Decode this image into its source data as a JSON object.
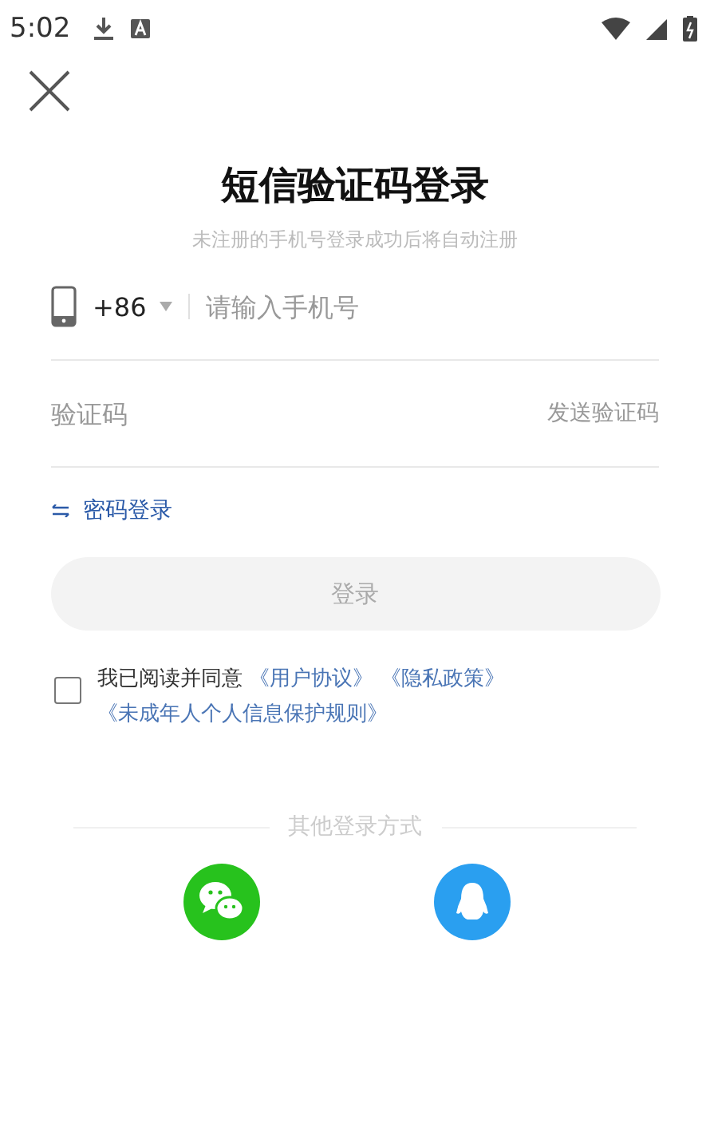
{
  "status_bar": {
    "time": "5:02"
  },
  "title": "短信验证码登录",
  "subtitle": "未注册的手机号登录成功后将自动注册",
  "phone": {
    "country_code": "+86",
    "placeholder": "请输入手机号"
  },
  "code": {
    "placeholder": "验证码",
    "send_label": "发送验证码"
  },
  "switch_login": {
    "label": "密码登录"
  },
  "login_button": {
    "label": "登录",
    "disabled": true
  },
  "agreement": {
    "checked": false,
    "text": "我已阅读并同意",
    "links": [
      "《用户协议》",
      "《隐私政策》",
      "《未成年人个人信息保护规则》"
    ]
  },
  "other_login": {
    "label": "其他登录方式",
    "options": [
      {
        "kind": "wechat"
      },
      {
        "kind": "qq"
      }
    ]
  }
}
